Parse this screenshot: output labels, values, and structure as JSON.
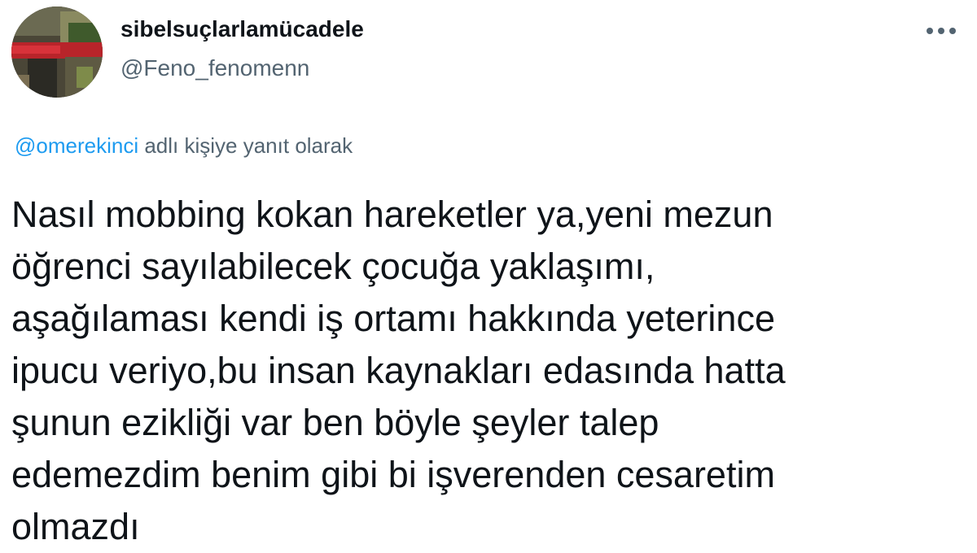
{
  "tweet": {
    "author": {
      "display_name": "sibelsuçlarlamücadele",
      "handle": "@Feno_fenomenn",
      "avatar_icon": "profile-photo"
    },
    "more_icon": "more-horizontal-icon",
    "reply_context": {
      "mention": "@omerekinci",
      "suffix": "adlı kişiye yanıt olarak"
    },
    "text_lines": [
      "Nasıl mobbing kokan hareketler ya,yeni mezun",
      "öğrenci sayılabilecek çocuğa yaklaşımı,",
      "aşağılaması kendi iş ortamı hakkında yeterince",
      "ipucu veriyo,bu insan kaynakları edasında hatta",
      "şunun ezikliği var ben böyle şeyler talep",
      "edemezdim benim gibi bi işverenden cesaretim",
      "olmazdı"
    ]
  },
  "colors": {
    "text_primary": "#0f1419",
    "text_secondary": "#536471",
    "link_blue": "#1d9bf0",
    "background": "#ffffff"
  }
}
